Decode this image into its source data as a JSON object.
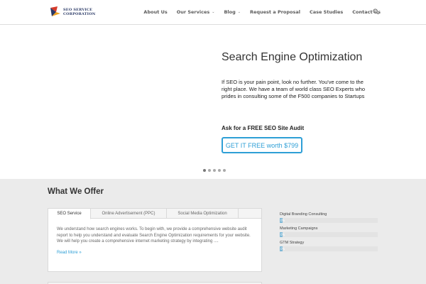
{
  "header": {
    "logo": {
      "line1": "SEO SERVICE",
      "line2": "CORPORATION"
    },
    "nav": [
      {
        "label": "About Us",
        "dropdown": false
      },
      {
        "label": "Our Services",
        "dropdown": true
      },
      {
        "label": "Blog",
        "dropdown": true
      },
      {
        "label": "Request a Proposal",
        "dropdown": false
      },
      {
        "label": "Case Studies",
        "dropdown": false
      },
      {
        "label": "Contact Us",
        "dropdown": false
      }
    ],
    "search_icon": "search-icon"
  },
  "hero": {
    "title": "Search Engine Optimization",
    "text": "If SEO is your pain point, look no further. You've come to the right place. We have a team of world class SEO Experts who prides in consulting some of the  F500 companies to Startups",
    "cta_label": "Ask for a FREE SEO Site Audit",
    "button_label": "GET IT FREE worth $799",
    "slides": 5,
    "active_slide": 1
  },
  "offer": {
    "title": "What We Offer",
    "tabs": [
      {
        "label": "SEO Service",
        "active": true
      },
      {
        "label": "Online Advertisement (PPC)",
        "active": false
      },
      {
        "label": "Social Media Optimization",
        "active": false
      }
    ],
    "body": "We understand how search engines works. To begin with, we provide a comprehensive website audit report to help you understand and evaluate Search Engine Optimization requirements for your website. We will help you create a comprehensive internet marketing strategy by integrating ....",
    "read_more": "Read More »"
  },
  "skills": [
    {
      "label": "Digital Branding Consulting",
      "value": 0.03,
      "pct": "0%"
    },
    {
      "label": "Marketing Campaigns",
      "value": 0.03,
      "pct": "0%"
    },
    {
      "label": "GTM Strategy",
      "value": 0.03,
      "pct": "0%"
    }
  ],
  "colors": {
    "accent": "#2e9fd6",
    "bar": "#7fb8d6",
    "background": "#ebebeb"
  }
}
